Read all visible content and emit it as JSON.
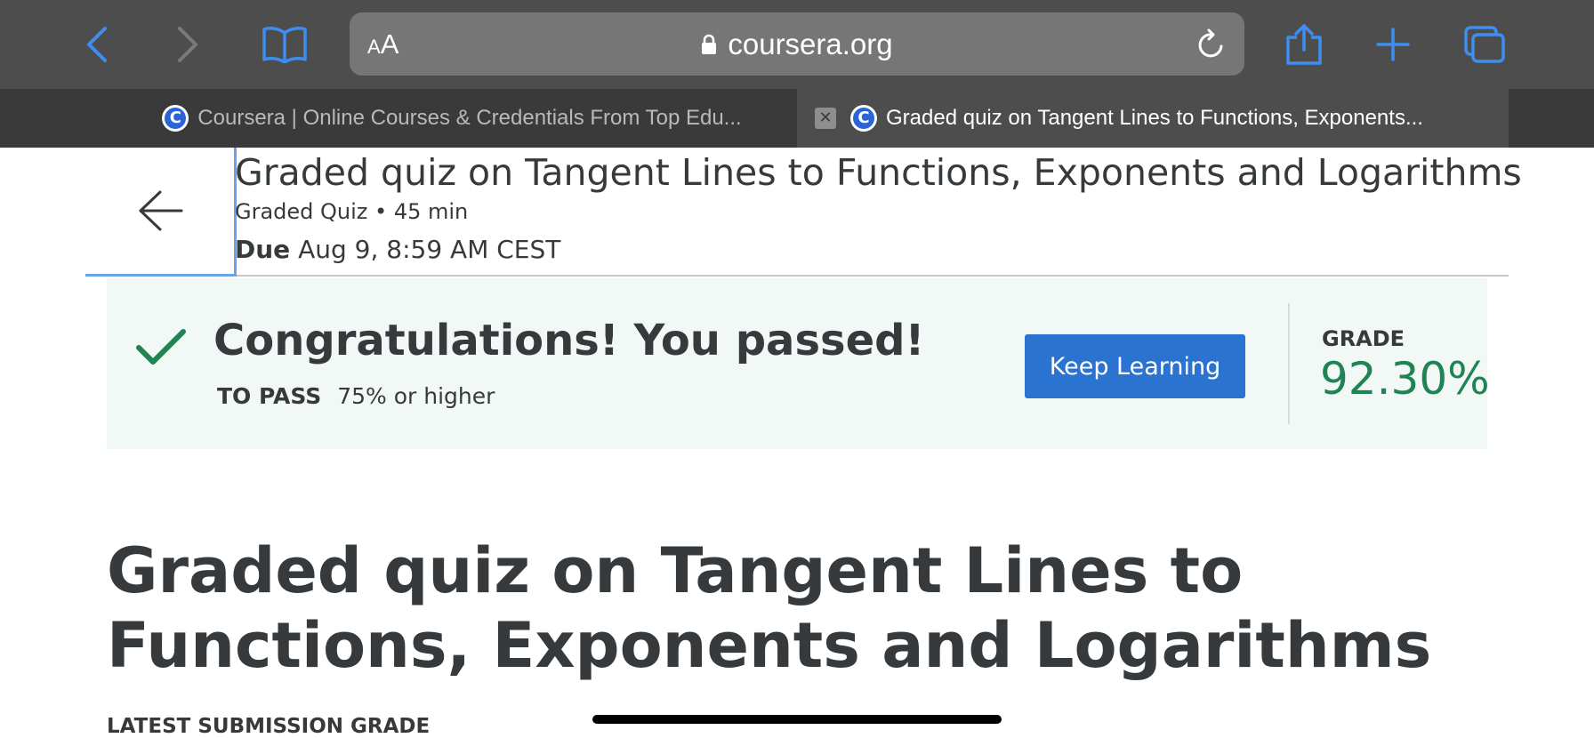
{
  "browser": {
    "address": {
      "aa_small": "A",
      "aa_big": "A",
      "host": "coursera.org"
    },
    "icons": {
      "back": "chevron-left-icon",
      "forward": "chevron-right-icon",
      "bookmarks": "book-icon",
      "lock": "lock-icon",
      "reload": "reload-icon",
      "share": "share-icon",
      "new_tab": "plus-icon",
      "tabs": "tabs-icon"
    },
    "tabs": [
      {
        "favicon": "C",
        "title": "Coursera | Online Courses & Credentials From Top Edu...",
        "active": false
      },
      {
        "favicon": "C",
        "close": "✕",
        "title": "Graded quiz on Tangent Lines to Functions, Exponents...",
        "active": true
      }
    ]
  },
  "header": {
    "title": "Graded quiz on Tangent Lines to Functions, Exponents and Logarithms",
    "meta": "Graded Quiz • 45 min",
    "due_label": "Due",
    "due_value": "Aug 9, 8:59 AM CEST"
  },
  "result": {
    "message": "Congratulations! You passed!",
    "to_pass_label": "TO PASS",
    "to_pass_value": "75% or higher",
    "button_label": "Keep Learning",
    "grade_label": "GRADE",
    "grade_value": "92.30%"
  },
  "main": {
    "title": "Graded quiz on Tangent Lines to Functions, Exponents and Logarithms",
    "latest_grade_label": "LATEST SUBMISSION GRADE"
  },
  "colors": {
    "toolbar_bg": "#4d4d4d",
    "accent_blue": "#2a73d0",
    "safari_blue": "#3d8ef0",
    "success_green": "#1f8354",
    "banner_bg": "#f2f8f6"
  }
}
